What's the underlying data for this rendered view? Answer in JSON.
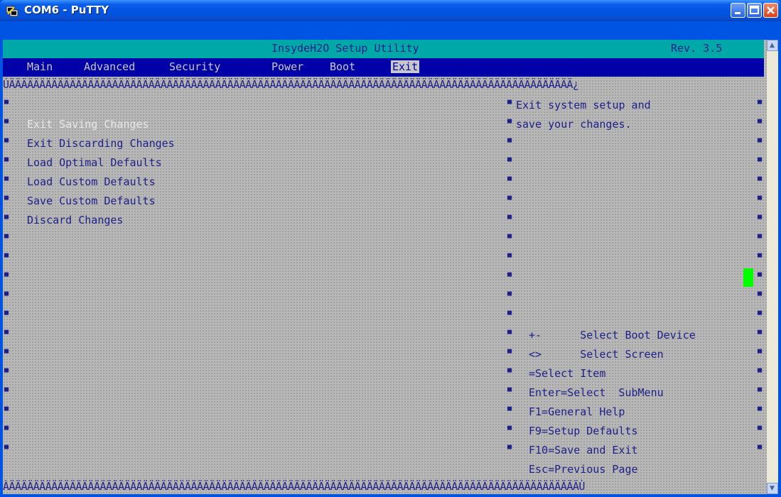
{
  "window": {
    "title": "COM6 - PuTTY"
  },
  "header": {
    "title": "InsydeH2O Setup Utility",
    "revision": "Rev. 3.5"
  },
  "menu": [
    {
      "label": "Main",
      "active": false
    },
    {
      "label": "Advanced",
      "active": false
    },
    {
      "label": "Security",
      "active": false
    },
    {
      "label": "Power",
      "active": false
    },
    {
      "label": "Boot",
      "active": false
    },
    {
      "label": "Exit",
      "active": true
    }
  ],
  "border_line_text": "ÚÄÄÄÄÄÄÄÄÄÄÄÄÄÄÄÄÄÄÄÄÄÄÄÄÄÄÄÄÄÄÄÄÄÄÄÄÄÄÄÄÄÄÄÄÄÄÄÄÄÄÄÄÄÄÄÄÄÄÄÄÄÄÄÄÄÄÄÄÄÄÄÄÄÄÄÄÄÄÄÄÄÄÄÄÄÄÄÄÄÄÄÄÄ¿",
  "bottom_line_text": "ÀÄÄÄÄÄÄÄÄÄÄÄÄÄÄÄÄÄÄÄÄÄÄÄÄÄÄÄÄÄÄÄÄÄÄÄÄÄÄÄÄÄÄÄÄÄÄÄÄÄÄÄÄÄÄÄÄÄÄÄÄÄÄÄÄÄÄÄÄÄÄÄÄÄÄÄÄÄÄÄÄÄÄÄÄÄÄÄÄÄÄÄÄÄÄÙ",
  "options": [
    {
      "label": "Exit Saving Changes",
      "selected": true
    },
    {
      "label": "Exit Discarding Changes",
      "selected": false
    },
    {
      "label": "Load Optimal Defaults",
      "selected": false
    },
    {
      "label": "Load Custom Defaults",
      "selected": false
    },
    {
      "label": "Save Custom Defaults",
      "selected": false
    },
    {
      "label": "Discard Changes",
      "selected": false
    }
  ],
  "help": {
    "line1": "Exit system setup and",
    "line2": "save your changes."
  },
  "keys": [
    {
      "key": "+-",
      "desc": "Select Boot Device"
    },
    {
      "key": "<>",
      "desc": "Select Screen"
    },
    {
      "key": "",
      "desc": "=Select Item"
    },
    {
      "key": "",
      "desc": "Enter=Select  SubMenu"
    },
    {
      "key": "",
      "desc": "F1=General Help"
    },
    {
      "key": "",
      "desc": "F9=Setup Defaults"
    },
    {
      "key": "",
      "desc": "F10=Save and Exit"
    },
    {
      "key": "",
      "desc": "Esc=Previous Page"
    }
  ],
  "colors": {
    "header_bg": "#00a8a8",
    "menubar_bg": "#0000a8",
    "text": "#1f1f8a",
    "cursor": "#00ff00"
  }
}
